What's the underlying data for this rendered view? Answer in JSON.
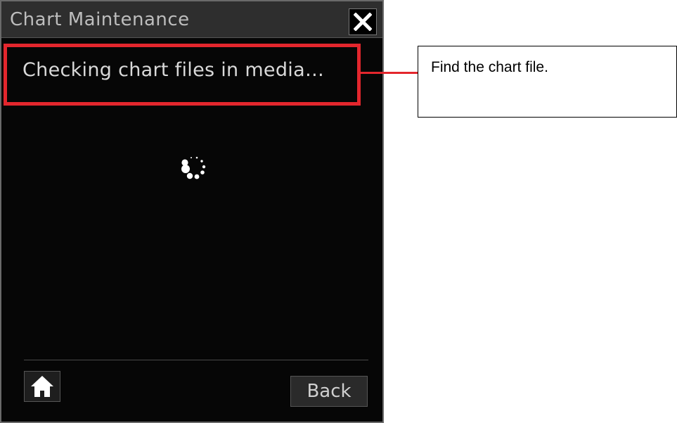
{
  "dialog": {
    "title": "Chart Maintenance",
    "status_text": "Checking chart files in media…",
    "back_label": "Back"
  },
  "annotation": {
    "callout_text": "Find the chart file.",
    "highlight_color": "#e3262d"
  },
  "icons": {
    "close": "close-icon",
    "home": "home-icon",
    "loading": "loading-spinner-icon"
  }
}
